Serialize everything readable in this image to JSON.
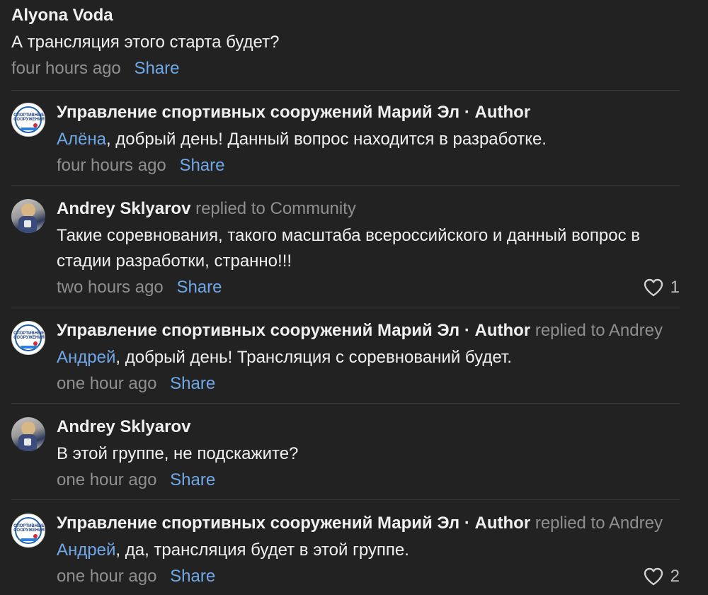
{
  "thread": {
    "top_comment": {
      "author": "Alyona Voda",
      "text": "А трансляция этого старта будет?",
      "timestamp": "four hours ago",
      "share_label": "Share"
    },
    "replies": [
      {
        "author": "Управление спортивных сооружений Марий Эл",
        "author_tag": "· Author",
        "replied_to": "",
        "mention": "Алёна",
        "text": ", добрый день! Данный вопрос находится в разработке.",
        "timestamp": "four hours ago",
        "share_label": "Share",
        "likes": ""
      },
      {
        "author": "Andrey Sklyarov",
        "author_tag": "",
        "replied_to": "replied to Community",
        "mention": "",
        "text": "Такие соревнования, такого масштаба всероссийского и данный вопрос в стадии разработки, странно!!!",
        "timestamp": "two hours ago",
        "share_label": "Share",
        "likes": "1"
      },
      {
        "author": "Управление спортивных сооружений Марий Эл",
        "author_tag": "· Author",
        "replied_to": "replied to Andrey",
        "mention": "Андрей",
        "text": ", добрый день! Трансляция с соревнований будет.",
        "timestamp": "one hour ago",
        "share_label": "Share",
        "likes": ""
      },
      {
        "author": "Andrey Sklyarov",
        "author_tag": "",
        "replied_to": "",
        "mention": "",
        "text": "В этой группе, не подскажите?",
        "timestamp": "one hour ago",
        "share_label": "Share",
        "likes": ""
      },
      {
        "author": "Управление спортивных сооружений Марий Эл",
        "author_tag": "· Author",
        "replied_to": "replied to Andrey",
        "mention": "Андрей",
        "text": ", да, трансляция будет в этой группе.",
        "timestamp": "one hour ago",
        "share_label": "Share",
        "likes": "2"
      }
    ],
    "org_avatar_label": "СПОРТИВНЫЕ СООРУЖЕНИЯ"
  },
  "colors": {
    "background": "#222222",
    "link": "#6fa8e8",
    "muted": "#8f8f8f",
    "divider": "#3a3a3a"
  }
}
